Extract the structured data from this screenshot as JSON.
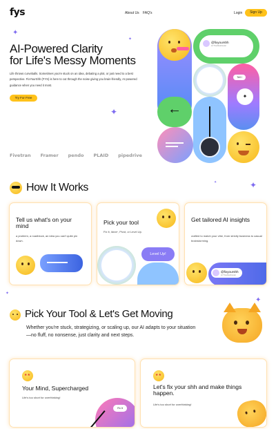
{
  "brand": {
    "logo_text": "fys"
  },
  "nav": {
    "links": [
      "About Us",
      "FAQ's"
    ],
    "login_label": "Login",
    "signup_label": "Sign Up"
  },
  "hero": {
    "title_line1": "AI-Powered Clarity",
    "title_line2": "for Life's Messy Moments",
    "body": "Life throws curveballs. Sometimes you're stuck on an idea, debating a plot, or just need to a best perspective. FixYourShh (FYS) is here to cut through the noise giving you brain-friendly, AI-powered guidance when you need it most.",
    "cta_label": "Try For Free"
  },
  "partners": [
    "Fivetran",
    "Framer",
    "pendo",
    "PLAID",
    "pipedrive"
  ],
  "collage": {
    "handle_name": "@fixyourshh",
    "handle_sub": "AI Troubleshooter",
    "tab_label": "Tell I",
    "arrow_glyph": "←"
  },
  "how_it_works": {
    "title": "How It Works",
    "cards": [
      {
        "title": "Tell us what's on your mind",
        "body": "a problem, a roadblock, an idea you can't quite pin down."
      },
      {
        "title": "Pick your tool",
        "body": "Fix It, Idea+, Pivot, or Level Up.",
        "badge": "Level Up!"
      },
      {
        "title": "Get tailored AI insights",
        "body": "crafted to match your vibe, from strictly business to casual brainstorming.",
        "handle_name": "@fixyourshh",
        "handle_sub": "AI Troubleshooter"
      }
    ]
  },
  "pick_tool": {
    "title": "Pick Your Tool & Let's Get Moving",
    "body": "Whether you're stuck, strategizing, or scaling up, our AI adapts to your situation—no fluff, no nonsense, just clarity and next steps."
  },
  "features": [
    {
      "title": "Your Mind, Supercharged",
      "body": "Life's too short for overthinking!",
      "tag": "Fix It"
    },
    {
      "title": "Let's fix your shh and make things happen.",
      "body": "Life's too short for overthinking!"
    }
  ],
  "colors": {
    "accent_yellow": "#ffc21a",
    "accent_purple": "#7e6bf0",
    "accent_green": "#5fd06a",
    "accent_blue": "#5a8ff0"
  }
}
